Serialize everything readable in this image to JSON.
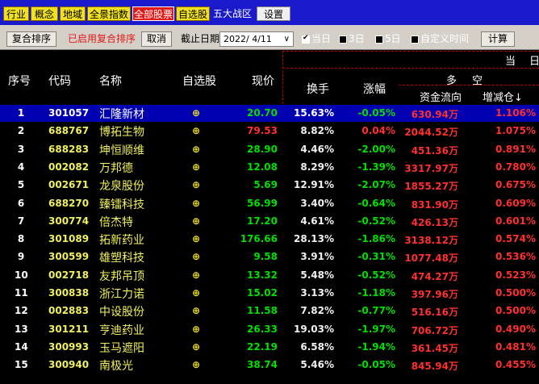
{
  "tabs": [
    "行业",
    "概念",
    "地域",
    "全景指数",
    "全部股票",
    "自选股",
    "五大战区",
    "设置"
  ],
  "toolbar": {
    "reset_sort": "复合排序",
    "sort_status": "已启用复合排序",
    "cancel": "取消",
    "date_label": "截止日期",
    "date_value": "2022/ 4/11",
    "opt_today": "当日",
    "opt_3d": "3日",
    "opt_5d": "5日",
    "opt_custom": "自定义时间",
    "calc": "计算"
  },
  "header": {
    "idx": "序号",
    "code": "代码",
    "name": "名称",
    "fav": "自选股",
    "price": "现价",
    "turnover": "换手",
    "change": "涨幅",
    "group_top": "当",
    "group_top2": "日",
    "duo": "多",
    "kong": "空",
    "flow": "资金流向",
    "position": "增减仓↓"
  },
  "rows": [
    {
      "idx": "1",
      "code": "301057",
      "name": "汇隆新材",
      "fav": "⊕",
      "price": "20.70",
      "turnover": "15.63%",
      "change": "-0.05%",
      "flow": "630.94万",
      "pos": "1.106%",
      "dir": "neg"
    },
    {
      "idx": "2",
      "code": "688767",
      "name": "博拓生物",
      "fav": "⊕",
      "price": "79.53",
      "turnover": "8.82%",
      "change": "0.04%",
      "flow": "2044.52万",
      "pos": "1.075%",
      "dir": "pos"
    },
    {
      "idx": "3",
      "code": "688283",
      "name": "坤恒顺维",
      "fav": "⊕",
      "price": "28.90",
      "turnover": "4.46%",
      "change": "-2.00%",
      "flow": "451.36万",
      "pos": "0.891%",
      "dir": "neg"
    },
    {
      "idx": "4",
      "code": "002082",
      "name": "万邦德",
      "fav": "⊕",
      "price": "12.08",
      "turnover": "8.29%",
      "change": "-1.39%",
      "flow": "3317.97万",
      "pos": "0.780%",
      "dir": "neg"
    },
    {
      "idx": "5",
      "code": "002671",
      "name": "龙泉股份",
      "fav": "⊕",
      "price": "5.69",
      "turnover": "12.91%",
      "change": "-2.07%",
      "flow": "1855.27万",
      "pos": "0.675%",
      "dir": "neg"
    },
    {
      "idx": "6",
      "code": "688270",
      "name": "臻镭科技",
      "fav": "⊕",
      "price": "56.99",
      "turnover": "3.40%",
      "change": "-0.64%",
      "flow": "831.90万",
      "pos": "0.609%",
      "dir": "neg"
    },
    {
      "idx": "7",
      "code": "300774",
      "name": "倍杰特",
      "fav": "⊕",
      "price": "17.20",
      "turnover": "4.61%",
      "change": "-0.52%",
      "flow": "426.13万",
      "pos": "0.601%",
      "dir": "neg"
    },
    {
      "idx": "8",
      "code": "301089",
      "name": "拓新药业",
      "fav": "⊕",
      "price": "176.66",
      "turnover": "28.13%",
      "change": "-1.86%",
      "flow": "3138.12万",
      "pos": "0.574%",
      "dir": "neg"
    },
    {
      "idx": "9",
      "code": "300599",
      "name": "雄塑科技",
      "fav": "⊕",
      "price": "9.58",
      "turnover": "3.91%",
      "change": "-0.31%",
      "flow": "1077.48万",
      "pos": "0.536%",
      "dir": "neg"
    },
    {
      "idx": "10",
      "code": "002718",
      "name": "友邦吊顶",
      "fav": "⊕",
      "price": "13.32",
      "turnover": "5.48%",
      "change": "-0.52%",
      "flow": "474.27万",
      "pos": "0.523%",
      "dir": "neg"
    },
    {
      "idx": "11",
      "code": "300838",
      "name": "浙江力诺",
      "fav": "⊕",
      "price": "15.02",
      "turnover": "3.13%",
      "change": "-1.18%",
      "flow": "397.96万",
      "pos": "0.500%",
      "dir": "neg"
    },
    {
      "idx": "12",
      "code": "002883",
      "name": "中设股份",
      "fav": "⊕",
      "price": "11.58",
      "turnover": "7.82%",
      "change": "-0.77%",
      "flow": "516.16万",
      "pos": "0.500%",
      "dir": "neg"
    },
    {
      "idx": "13",
      "code": "301211",
      "name": "亨迪药业",
      "fav": "⊕",
      "price": "26.33",
      "turnover": "19.03%",
      "change": "-1.97%",
      "flow": "706.72万",
      "pos": "0.490%",
      "dir": "neg"
    },
    {
      "idx": "14",
      "code": "300993",
      "name": "玉马遮阳",
      "fav": "⊕",
      "price": "22.19",
      "turnover": "6.58%",
      "change": "-1.94%",
      "flow": "361.45万",
      "pos": "0.481%",
      "dir": "neg"
    },
    {
      "idx": "15",
      "code": "300940",
      "name": "南极光",
      "fav": "⊕",
      "price": "38.74",
      "turnover": "5.46%",
      "change": "-0.05%",
      "flow": "845.94万",
      "pos": "0.455%",
      "dir": "neg"
    }
  ],
  "colors": {
    "up": "#ff3030",
    "down": "#00e000",
    "selected_row": "#0000b0"
  }
}
